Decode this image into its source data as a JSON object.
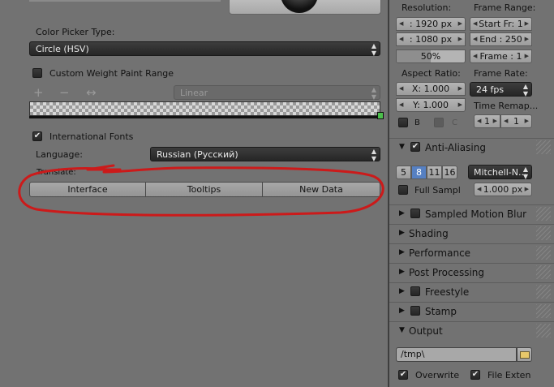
{
  "color_picker": {
    "label": "Color Picker Type:",
    "value": "Circle (HSV)"
  },
  "weight_paint": {
    "label": "Custom Weight Paint Range",
    "plus": "+",
    "minus": "−",
    "swap": "↔",
    "interp": "Linear"
  },
  "fonts": {
    "label": "International Fonts",
    "checked": true
  },
  "language": {
    "label": "Language:",
    "value": "Russian (Русский)"
  },
  "translate": {
    "label": "Translate:",
    "buttons": [
      "Interface",
      "Tooltips",
      "New Data"
    ]
  },
  "annotation": {
    "color": "#cc1a1a"
  },
  "render": {
    "resolution_label": "Resolution:",
    "res_x": ": 1920 px",
    "res_y": ": 1080 px",
    "res_pct": "50%",
    "res_pct_fill": 0.5,
    "frame_range_label": "Frame Range:",
    "start": "Start Fr: 1",
    "end": "End : 250",
    "frame": "Frame : 1",
    "aspect_label": "Aspect Ratio:",
    "aspect_x": "X:  1.000",
    "aspect_y": "Y:  1.000",
    "frame_rate_label": "Frame Rate:",
    "fps": "24 fps",
    "time_remap_label": "Time Remap...",
    "remap_a": "1",
    "remap_b": "1",
    "b": "B",
    "c": "C"
  },
  "aa": {
    "title": "Anti-Aliasing",
    "samples": [
      "5",
      "8",
      "11",
      "16"
    ],
    "selected": "8",
    "filter": "Mitchell-N...",
    "full_sample": "Full Sampl",
    "size": "1.000 px"
  },
  "sections": [
    {
      "title": "Sampled Motion Blur",
      "checkbox": true
    },
    {
      "title": "Shading",
      "checkbox": false
    },
    {
      "title": "Performance",
      "checkbox": false
    },
    {
      "title": "Post Processing",
      "checkbox": false
    },
    {
      "title": "Freestyle",
      "checkbox": true
    },
    {
      "title": "Stamp",
      "checkbox": true
    }
  ],
  "output": {
    "title": "Output",
    "path": "/tmp\\",
    "overwrite": "Overwrite",
    "file_ext": "File Exten"
  }
}
